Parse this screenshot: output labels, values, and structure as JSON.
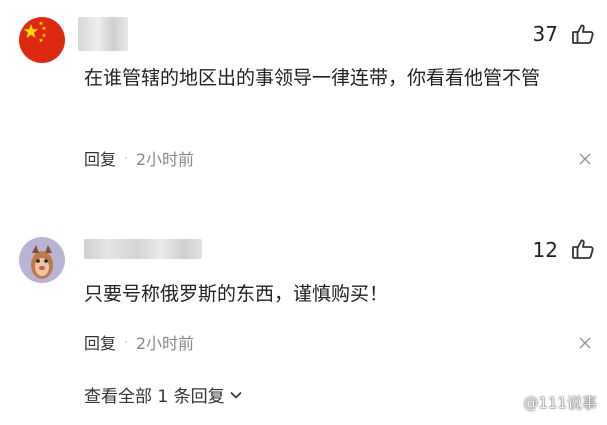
{
  "comments": [
    {
      "like_count": "37",
      "text": "在谁管辖的地区出的事领导一律连带，你看看他管不管",
      "reply_label": "回复",
      "timestamp": "2小时前"
    },
    {
      "like_count": "12",
      "text": "只要号称俄罗斯的东西，谨慎购买！",
      "reply_label": "回复",
      "timestamp": "2小时前"
    }
  ],
  "view_replies_label": "查看全部 1 条回复",
  "watermark": "@111说事",
  "icons": {
    "like": "thumbs-up-icon",
    "more": "close-icon",
    "expand": "chevron-down-icon"
  },
  "colors": {
    "flag_red": "#DE2910",
    "flag_star": "#FFDE00"
  }
}
